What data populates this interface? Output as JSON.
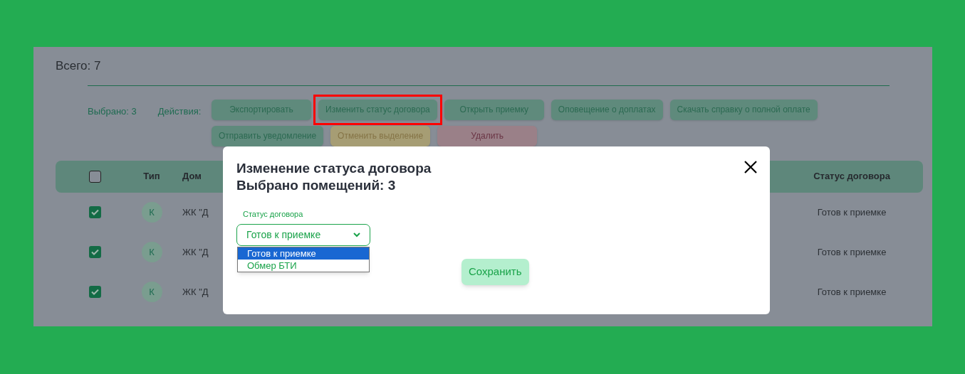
{
  "summary": {
    "total": "Всего: 7",
    "selected_count": "Выбрано: 3",
    "actions_label": "Действия:"
  },
  "actions": [
    {
      "label": "Экспортировать",
      "kind": "green",
      "highlighted": false
    },
    {
      "label": "Изменить статус договора",
      "kind": "green",
      "highlighted": true
    },
    {
      "label": "Открыть приемку",
      "kind": "green",
      "highlighted": false
    },
    {
      "label": "Оповещение о доплатах",
      "kind": "green",
      "highlighted": false
    },
    {
      "label": "Скачать справку о полной оплате",
      "kind": "green",
      "highlighted": false
    },
    {
      "label": "Отправить уведомление",
      "kind": "green",
      "highlighted": false
    },
    {
      "label": "Отменить выделение",
      "kind": "yellow",
      "highlighted": false
    },
    {
      "label": "Удалить",
      "kind": "red",
      "highlighted": false
    }
  ],
  "table": {
    "header_checked": false,
    "columns": [
      "Тип",
      "Дом",
      "Статус договора"
    ],
    "rows": [
      {
        "checked": true,
        "type": "К",
        "house": "ЖК \"Д",
        "status": "Готов к приемке"
      },
      {
        "checked": true,
        "type": "К",
        "house": "ЖК \"Д",
        "status": "Готов к приемке"
      },
      {
        "checked": true,
        "type": "К",
        "house": "ЖК \"Д",
        "status": "Готов к приемке"
      }
    ]
  },
  "modal": {
    "title": "Изменение статуса договора",
    "subtitle": "Выбрано помещений: 3",
    "field_label": "Статус договора",
    "value": "Готов к приемке",
    "options": [
      {
        "label": "Готов к приемке",
        "selected": true
      },
      {
        "label": "Обмер БТИ",
        "selected": false
      }
    ],
    "save": "Сохранить"
  }
}
